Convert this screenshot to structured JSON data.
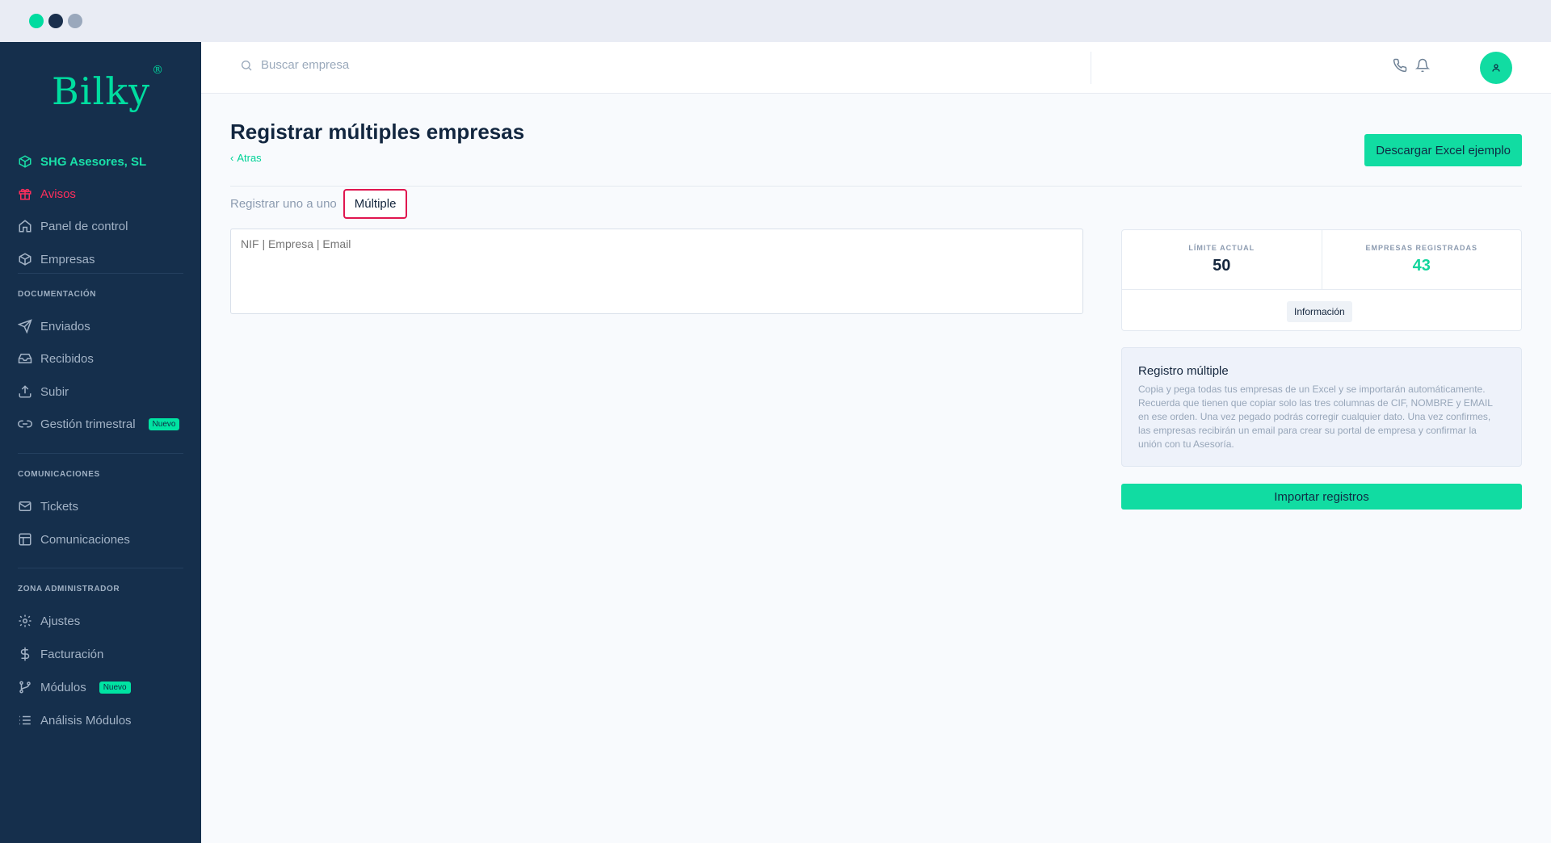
{
  "window": {
    "dots": [
      "#00dca0",
      "#1a2f4c",
      "#9aa8bc"
    ]
  },
  "brand": {
    "name": "Bilky",
    "mark": "®",
    "accent": "#00dda0"
  },
  "sidebar": {
    "company": "SHG Asesores, SL",
    "items_top": [
      {
        "label": "Avisos",
        "icon": "gift-icon"
      },
      {
        "label": "Panel de control",
        "icon": "home-icon"
      },
      {
        "label": "Empresas",
        "icon": "box-icon"
      }
    ],
    "sections": [
      {
        "title": "DOCUMENTACIÓN",
        "items": [
          {
            "label": "Enviados",
            "icon": "send-icon"
          },
          {
            "label": "Recibidos",
            "icon": "inbox-icon"
          },
          {
            "label": "Subir",
            "icon": "upload-icon"
          },
          {
            "label": "Gestión trimestral",
            "icon": "link-icon",
            "badge": "Nuevo"
          }
        ]
      },
      {
        "title": "COMUNICACIONES",
        "items": [
          {
            "label": "Tickets",
            "icon": "mail-icon"
          },
          {
            "label": "Comunicaciones",
            "icon": "layout-icon"
          }
        ]
      },
      {
        "title": "ZONA ADMINISTRADOR",
        "items": [
          {
            "label": "Ajustes",
            "icon": "gear-icon"
          },
          {
            "label": "Facturación",
            "icon": "dollar-icon"
          },
          {
            "label": "Módulos",
            "icon": "git-branch-icon",
            "badge": "Nuevo"
          },
          {
            "label": "Análisis Módulos",
            "icon": "list-icon"
          }
        ]
      }
    ]
  },
  "topbar": {
    "search_placeholder": "Buscar empresa"
  },
  "page": {
    "title": "Registrar múltiples empresas",
    "back": "Atras",
    "excel_button": "Descargar Excel ejemplo",
    "tabs": [
      "Registrar uno a uno",
      "Múltiple"
    ],
    "textarea_placeholder": "NIF | Empresa | Email"
  },
  "stats": {
    "limit_label": "LÍMITE ACTUAL",
    "limit_value": "50",
    "registered_label": "EMPRESAS REGISTRADAS",
    "registered_value": "43",
    "info_button": "Información"
  },
  "help": {
    "title": "Registro múltiple",
    "text": "Copia y pega todas tus empresas de un Excel y se importarán automáticamente. Recuerda que tienen que copiar solo las tres columnas de CIF, NOMBRE y EMAIL en ese orden. Una vez pegado podrás corregir cualquier dato. Una vez confirmes, las empresas recibirán un email para crear su portal de empresa y confirmar la unión con tu Asesoría."
  },
  "import_button": "Importar registros"
}
